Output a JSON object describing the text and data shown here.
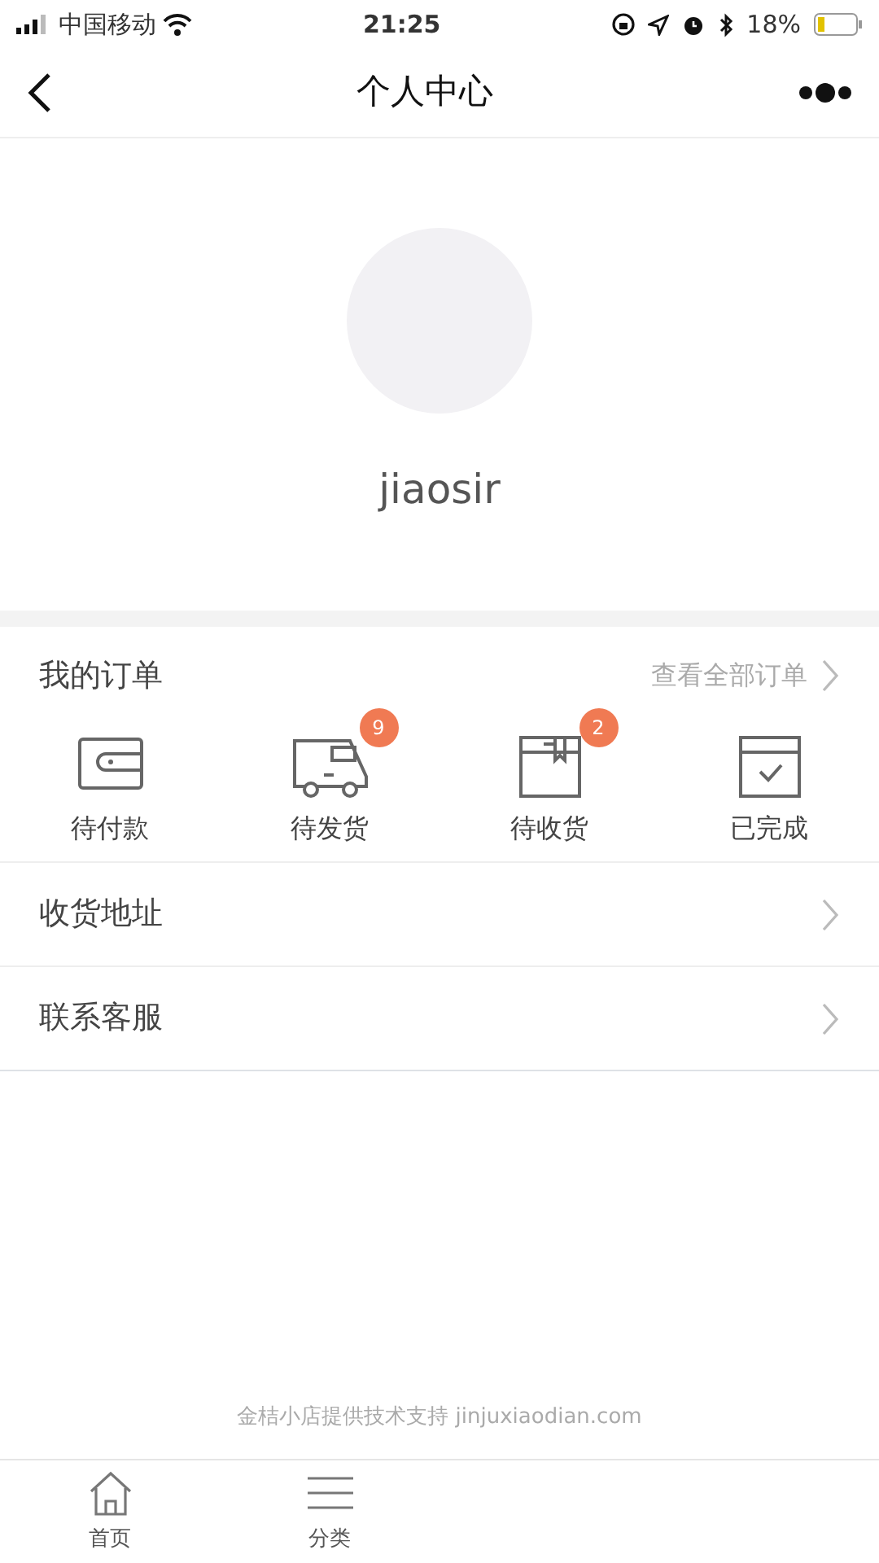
{
  "status_bar": {
    "carrier": "中国移动",
    "time": "21:25",
    "battery": "18%"
  },
  "nav": {
    "title": "个人中心"
  },
  "profile": {
    "username": "jiaosir"
  },
  "orders": {
    "title": "我的订单",
    "view_all": "查看全部订单",
    "items": [
      {
        "kind": "wallet",
        "label": "待付款"
      },
      {
        "kind": "truck",
        "label": "待发货",
        "badge": "9"
      },
      {
        "kind": "box",
        "label": "待收货",
        "badge": "2"
      },
      {
        "kind": "done",
        "label": "已完成"
      }
    ]
  },
  "menu": [
    {
      "label": "收货地址"
    },
    {
      "label": "联系客服"
    }
  ],
  "footer": "金桔小店提供技术支持 jinjuxiaodian.com",
  "tab_bar": [
    {
      "kind": "home",
      "label": "首页"
    },
    {
      "kind": "list",
      "label": "分类"
    }
  ]
}
